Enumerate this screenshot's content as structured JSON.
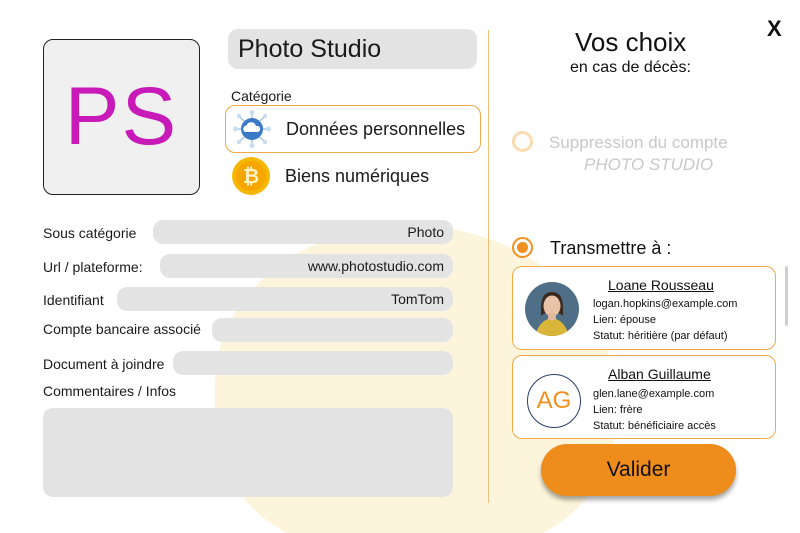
{
  "account": {
    "logo_text": "PS",
    "name": "Photo Studio"
  },
  "category": {
    "label": "Catégorie",
    "options": [
      {
        "label": "Données personnelles",
        "icon": "cloud-network-icon",
        "selected": true
      },
      {
        "label": "Biens numériques",
        "icon": "bitcoin-icon",
        "selected": false
      }
    ]
  },
  "fields": {
    "subcategory": {
      "label": "Sous catégorie",
      "value": "Photo"
    },
    "url": {
      "label": "Url / plateforme:",
      "value": "www.photostudio.com"
    },
    "identifier": {
      "label": "Identifiant",
      "value": "TomTom"
    },
    "bank": {
      "label": "Compte bancaire associé",
      "value": ""
    },
    "document": {
      "label": "Document à joindre",
      "value": ""
    },
    "comments": {
      "label": "Commentaires / Infos",
      "value": ""
    }
  },
  "choices": {
    "title": "Vos choix",
    "subtitle": "en cas de décès:",
    "close_label": "X",
    "delete_option": {
      "line1": "Suppression du compte",
      "line2": "PHOTO STUDIO",
      "selected": false
    },
    "transmit_option": {
      "label": "Transmettre à :",
      "selected": true
    }
  },
  "recipients": [
    {
      "name": "Loane Rousseau",
      "email": "logan.hopkins@example.com",
      "relation": "Lien: épouse",
      "status": "Statut: héritière (par défaut)",
      "avatar": "photo"
    },
    {
      "name": "Alban Guillaume",
      "initials": "AG",
      "email": "glen.lane@example.com",
      "relation": "Lien: frère",
      "status": "Statut: bénéficiaire accès",
      "avatar": "initials"
    }
  ],
  "actions": {
    "validate_label": "Valider"
  },
  "colors": {
    "accent": "#ef8d1c",
    "logo": "#c81ab9",
    "field_bg": "#e3e3e3"
  }
}
